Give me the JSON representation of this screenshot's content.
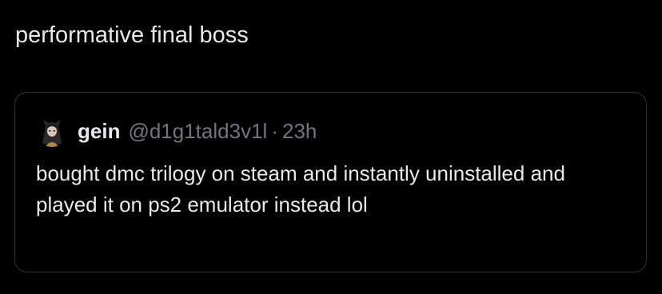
{
  "post": {
    "text": "performative final boss"
  },
  "quoted_post": {
    "avatar_icon": "anime-character-avatar-icon",
    "display_name": "gein",
    "handle": "@d1g1tald3v1l",
    "separator": "·",
    "timestamp": "23h",
    "text": "bought dmc trilogy on steam and instantly uninstalled and played it on ps2 emulator instead lol"
  },
  "colors": {
    "background": "#000000",
    "primary_text": "#e7e9ea",
    "secondary_text": "#71767b",
    "border": "#2f3336"
  }
}
